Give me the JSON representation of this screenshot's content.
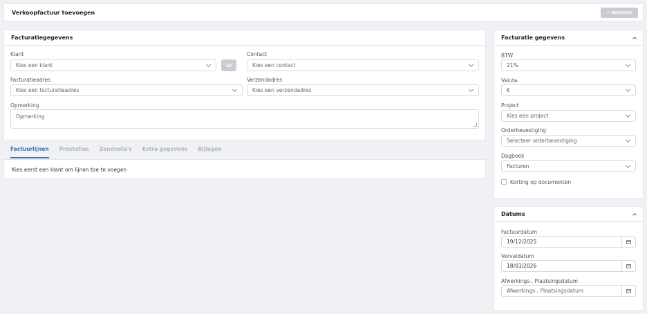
{
  "header": {
    "title": "Verkoopfactuur toevoegen",
    "save_label": "BEWAREN"
  },
  "main": {
    "section_title": "Facturatiegegevens",
    "klant": {
      "label": "Klant",
      "placeholder": "Kies een klant"
    },
    "contact": {
      "label": "Contact",
      "placeholder": "Kies een contact"
    },
    "facturatieadres": {
      "label": "Facturatieadres",
      "placeholder": "Kies een facturatieadres"
    },
    "verzendadres": {
      "label": "Verzendadres",
      "placeholder": "Kies een verzendadres"
    },
    "opmerking": {
      "label": "Opmerking",
      "placeholder": "Opmerking"
    }
  },
  "tabs": [
    {
      "label": "Factuurlijnen",
      "active": true
    },
    {
      "label": "Prestaties"
    },
    {
      "label": "Zendnota's"
    },
    {
      "label": "Extra gegevens"
    },
    {
      "label": "Bijlagen"
    }
  ],
  "lines_message": "Kies eerst een klant om lijnen toe te voegen",
  "sidebar": {
    "title": "Facturatie gegevens",
    "btw": {
      "label": "BTW",
      "value": "21%"
    },
    "valuta": {
      "label": "Valuta",
      "value": "€"
    },
    "project": {
      "label": "Project",
      "placeholder": "Kies een project"
    },
    "orderbevestiging": {
      "label": "Orderbevestiging",
      "placeholder": "Selecteer orderbevestiging"
    },
    "dagboek": {
      "label": "Dagboek",
      "value": "Facturen"
    },
    "korting_label": "Korting op documenten"
  },
  "datums": {
    "title": "Datums",
    "factuurdatum": {
      "label": "Factuurdatum",
      "value": "19/12/2025"
    },
    "vervaldatum": {
      "label": "Vervaldatum",
      "value": "18/01/2026"
    },
    "afwerkingsdatum": {
      "label": "Afwerkings-, Plaatsingsdatum",
      "placeholder": "Afwerkings-, Plaatsingsdatum"
    }
  },
  "colors": {
    "accent": "#3f6fb5",
    "disabled_button": "#c9ccd2",
    "background": "#f0f1f5"
  }
}
